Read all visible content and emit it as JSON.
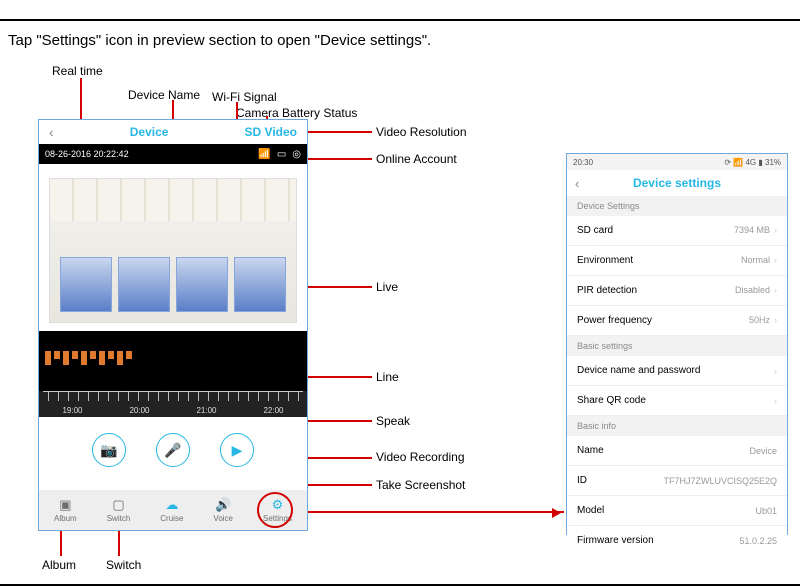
{
  "caption": "Tap \"Settings\" icon in preview section to open \"Device settings\".",
  "annotations": {
    "real_time": "Real time",
    "device_name": "Device Name",
    "wifi_signal": "Wi-Fi Signal",
    "battery": "Camera Battery Status",
    "video_res": "Video Resolution",
    "online_account": "Online Account",
    "live": "Live",
    "line": "Line",
    "speak": "Speak",
    "video_recording": "Video Recording",
    "screenshot": "Take Screenshot",
    "album": "Album",
    "switch": "Switch"
  },
  "preview": {
    "back": "‹",
    "title": "Device",
    "resolution": "SD Video",
    "timestamp": "08-26-2016 20:22:42",
    "icons": {
      "wifi": "📶",
      "battery": "▭",
      "account": "◎"
    },
    "ruler_times": [
      "19:00",
      "20:00",
      "21:00",
      "22:00"
    ],
    "controls": {
      "screenshot": "📷",
      "mic": "🎤",
      "record": "▶"
    },
    "bottom": {
      "album": {
        "icon": "▣",
        "label": "Album"
      },
      "switch": {
        "icon": "▢",
        "label": "Switch"
      },
      "cruise": {
        "icon": "☁",
        "label": "Cruise"
      },
      "voice": {
        "icon": "🔊",
        "label": "Voice"
      },
      "settings": {
        "icon": "⚙",
        "label": "Settings"
      }
    }
  },
  "settings": {
    "status_time": "20:30",
    "status_icons": "⟳ 📶 4G ▮ 31%",
    "back": "‹",
    "title": "Device settings",
    "section_device": "Device Settings",
    "rows_device": [
      {
        "label": "SD card",
        "value": "7394 MB"
      },
      {
        "label": "Environment",
        "value": "Normal"
      },
      {
        "label": "PIR detection",
        "value": "Disabled"
      },
      {
        "label": "Power frequency",
        "value": "50Hz"
      }
    ],
    "section_basic": "Basic settings",
    "rows_basic": [
      {
        "label": "Device name and password",
        "value": ""
      },
      {
        "label": "Share QR code",
        "value": ""
      }
    ],
    "section_info": "Basic info",
    "rows_info": [
      {
        "label": "Name",
        "value": "Device"
      },
      {
        "label": "ID",
        "value": "TF7HJ7ZWLUVCISQ25E2Q"
      },
      {
        "label": "Model",
        "value": "Ub01"
      },
      {
        "label": "Firmware version",
        "value": "51.0.2.25"
      }
    ]
  }
}
